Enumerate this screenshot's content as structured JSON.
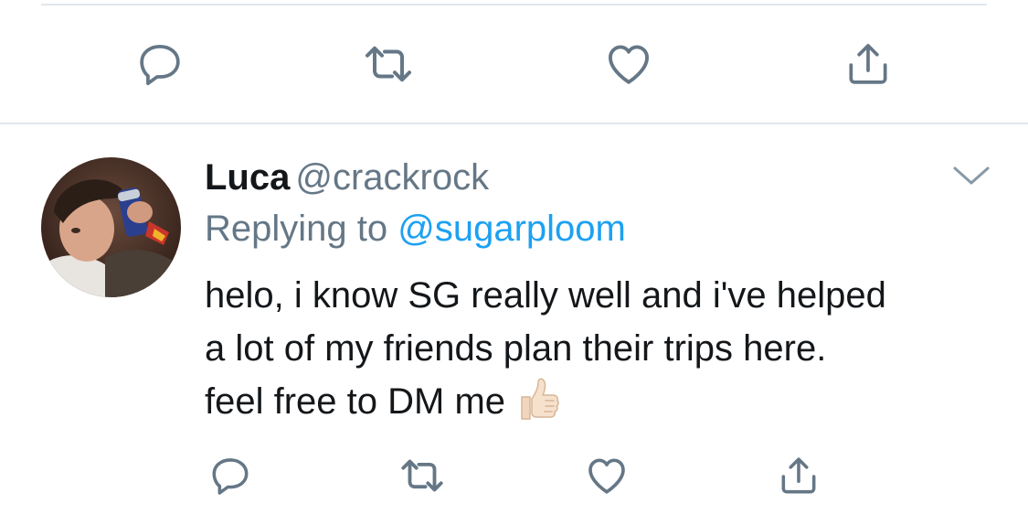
{
  "previous_tweet": {
    "actions": [
      {
        "name": "reply",
        "icon": "reply-icon"
      },
      {
        "name": "retweet",
        "icon": "retweet-icon"
      },
      {
        "name": "like",
        "icon": "heart-icon"
      },
      {
        "name": "share",
        "icon": "share-icon"
      }
    ]
  },
  "tweet": {
    "author": {
      "display_name": "Luca",
      "handle": "@crackrock",
      "avatar": "avatar-photo"
    },
    "replying_to_label": "Replying to",
    "replying_to_handle": "@sugarploom",
    "text_lines": [
      "helo, i know SG really well and i've helped",
      "a lot of my friends plan their trips here.",
      "feel free to DM me"
    ],
    "emoji": "thumbs-up-icon",
    "menu_icon": "chevron-down-icon",
    "actions": [
      {
        "name": "reply",
        "icon": "reply-icon"
      },
      {
        "name": "retweet",
        "icon": "retweet-icon"
      },
      {
        "name": "like",
        "icon": "heart-icon"
      },
      {
        "name": "share",
        "icon": "share-icon"
      }
    ]
  },
  "colors": {
    "text": "#14171a",
    "secondary": "#657786",
    "link": "#1da1f2",
    "divider": "#e1e8ed"
  }
}
